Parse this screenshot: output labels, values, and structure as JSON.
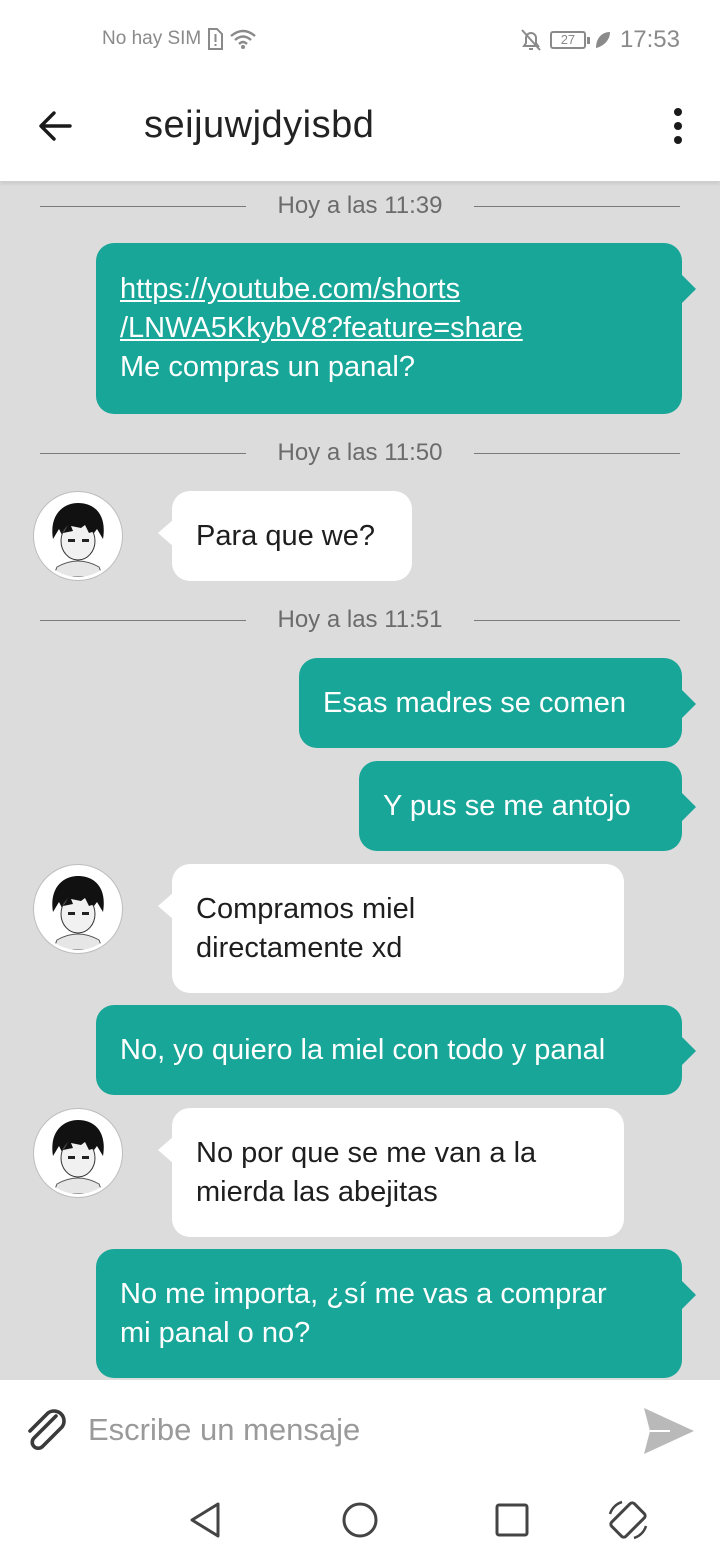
{
  "status_bar": {
    "carrier": "No hay SIM",
    "battery": "27",
    "time": "17:53"
  },
  "header": {
    "title": "seijuwjdyisbd",
    "back_icon": "arrow-left-icon",
    "menu_icon": "more-vertical-icon"
  },
  "messages": [
    {
      "type": "divider",
      "text": "Hoy a las 11:39"
    },
    {
      "type": "out",
      "link_line1": "https://youtube.com/shorts",
      "link_line2": "/LNWA5KkybV8?feature=share",
      "text": "Me compras un panal?"
    },
    {
      "type": "divider",
      "text": "Hoy a las 11:50"
    },
    {
      "type": "in",
      "text": "Para que we?"
    },
    {
      "type": "divider",
      "text": "Hoy a las 11:51"
    },
    {
      "type": "out",
      "text": "Esas madres se comen"
    },
    {
      "type": "out",
      "text": "Y pus se me antojo"
    },
    {
      "type": "in",
      "line1": "Compramos miel",
      "line2": "directamente xd"
    },
    {
      "type": "out",
      "text": "No, yo quiero la miel con todo y panal"
    },
    {
      "type": "in",
      "line1": "No por que se me van a la",
      "line2": "mierda las abejitas"
    },
    {
      "type": "out",
      "line1": "No me importa, ¿sí me vas a comprar",
      "line2": "mi panal o no?"
    }
  ],
  "composer": {
    "placeholder": "Escribe un mensaje",
    "attach_icon": "paperclip-icon",
    "send_icon": "send-icon"
  },
  "colors": {
    "outgoing_bubble": "#17a697",
    "incoming_bubble": "#ffffff",
    "chat_background": "#dcdcdc"
  }
}
